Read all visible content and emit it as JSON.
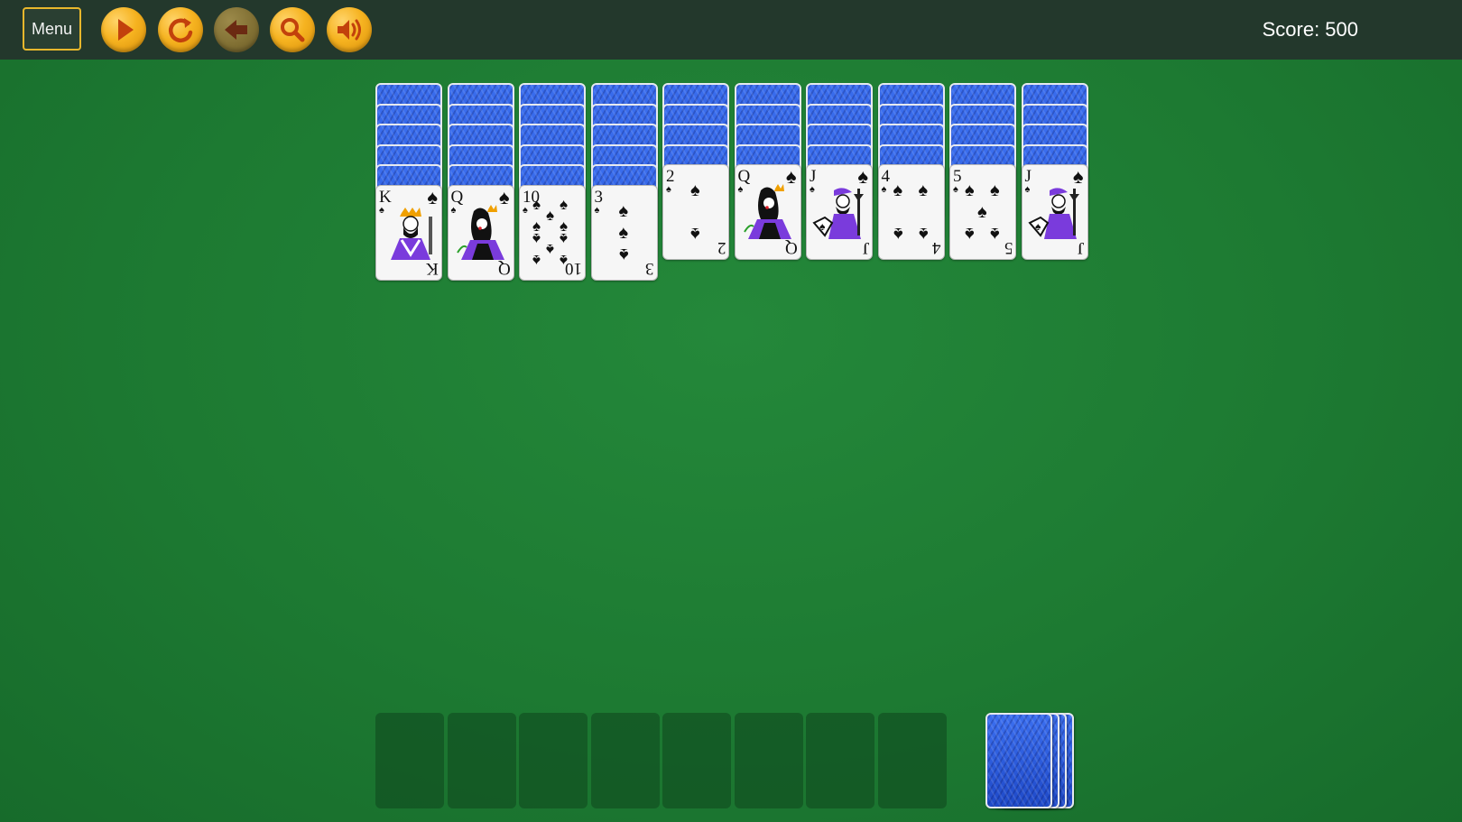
{
  "toolbar": {
    "menu_label": "Menu",
    "buttons": [
      {
        "name": "play-button",
        "icon": "play-icon"
      },
      {
        "name": "restart-button",
        "icon": "restart-icon"
      },
      {
        "name": "undo-button",
        "icon": "undo-arrow-icon",
        "disabled": true
      },
      {
        "name": "hint-button",
        "icon": "magnifier-icon"
      },
      {
        "name": "sound-button",
        "icon": "speaker-icon"
      }
    ],
    "score_label": "Score: 500"
  },
  "colors": {
    "felt": "#1d7a32",
    "topbar": "#23382c",
    "accent": "#e8b72c",
    "card_back": "#2a5ae0"
  },
  "tableau": [
    {
      "hidden": 5,
      "face": {
        "rank": "K",
        "suit": "♠",
        "type": "king"
      }
    },
    {
      "hidden": 5,
      "face": {
        "rank": "Q",
        "suit": "♠",
        "type": "queen"
      }
    },
    {
      "hidden": 5,
      "face": {
        "rank": "10",
        "suit": "♠",
        "type": "pips"
      }
    },
    {
      "hidden": 5,
      "face": {
        "rank": "3",
        "suit": "♠",
        "type": "pips"
      }
    },
    {
      "hidden": 4,
      "face": {
        "rank": "2",
        "suit": "♠",
        "type": "pips"
      }
    },
    {
      "hidden": 4,
      "face": {
        "rank": "Q",
        "suit": "♠",
        "type": "queen"
      }
    },
    {
      "hidden": 4,
      "face": {
        "rank": "J",
        "suit": "♠",
        "type": "jack"
      }
    },
    {
      "hidden": 4,
      "face": {
        "rank": "4",
        "suit": "♠",
        "type": "pips"
      }
    },
    {
      "hidden": 4,
      "face": {
        "rank": "5",
        "suit": "♠",
        "type": "pips"
      }
    },
    {
      "hidden": 4,
      "face": {
        "rank": "J",
        "suit": "♠",
        "type": "jack"
      }
    }
  ],
  "foundations": {
    "empty_slots": 8
  },
  "stock": {
    "remaining_deals": 4
  }
}
